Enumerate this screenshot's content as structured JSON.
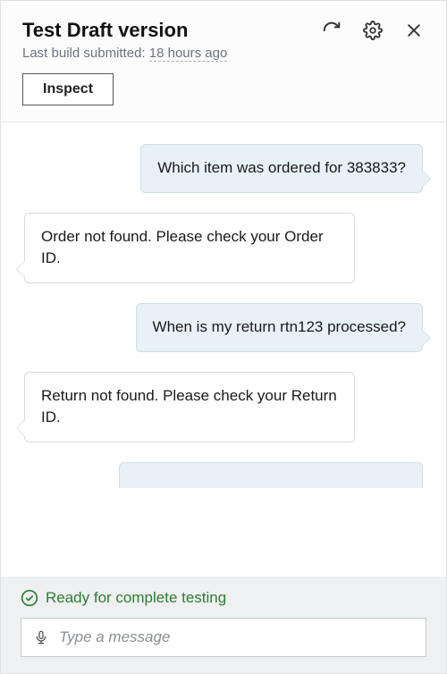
{
  "header": {
    "title": "Test Draft version",
    "subtitle_label": "Last build submitted: ",
    "subtitle_value": "18 hours ago",
    "inspect_label": "Inspect"
  },
  "messages": [
    {
      "role": "user",
      "text": "Which item was ordered for 383833?"
    },
    {
      "role": "bot",
      "text": "Order not found. Please check your Order ID."
    },
    {
      "role": "user",
      "text": "When is my return rtn123 processed?"
    },
    {
      "role": "bot",
      "text": "Return not found. Please check your Return ID."
    }
  ],
  "status": {
    "text": "Ready for complete testing"
  },
  "input": {
    "placeholder": "Type a message"
  }
}
